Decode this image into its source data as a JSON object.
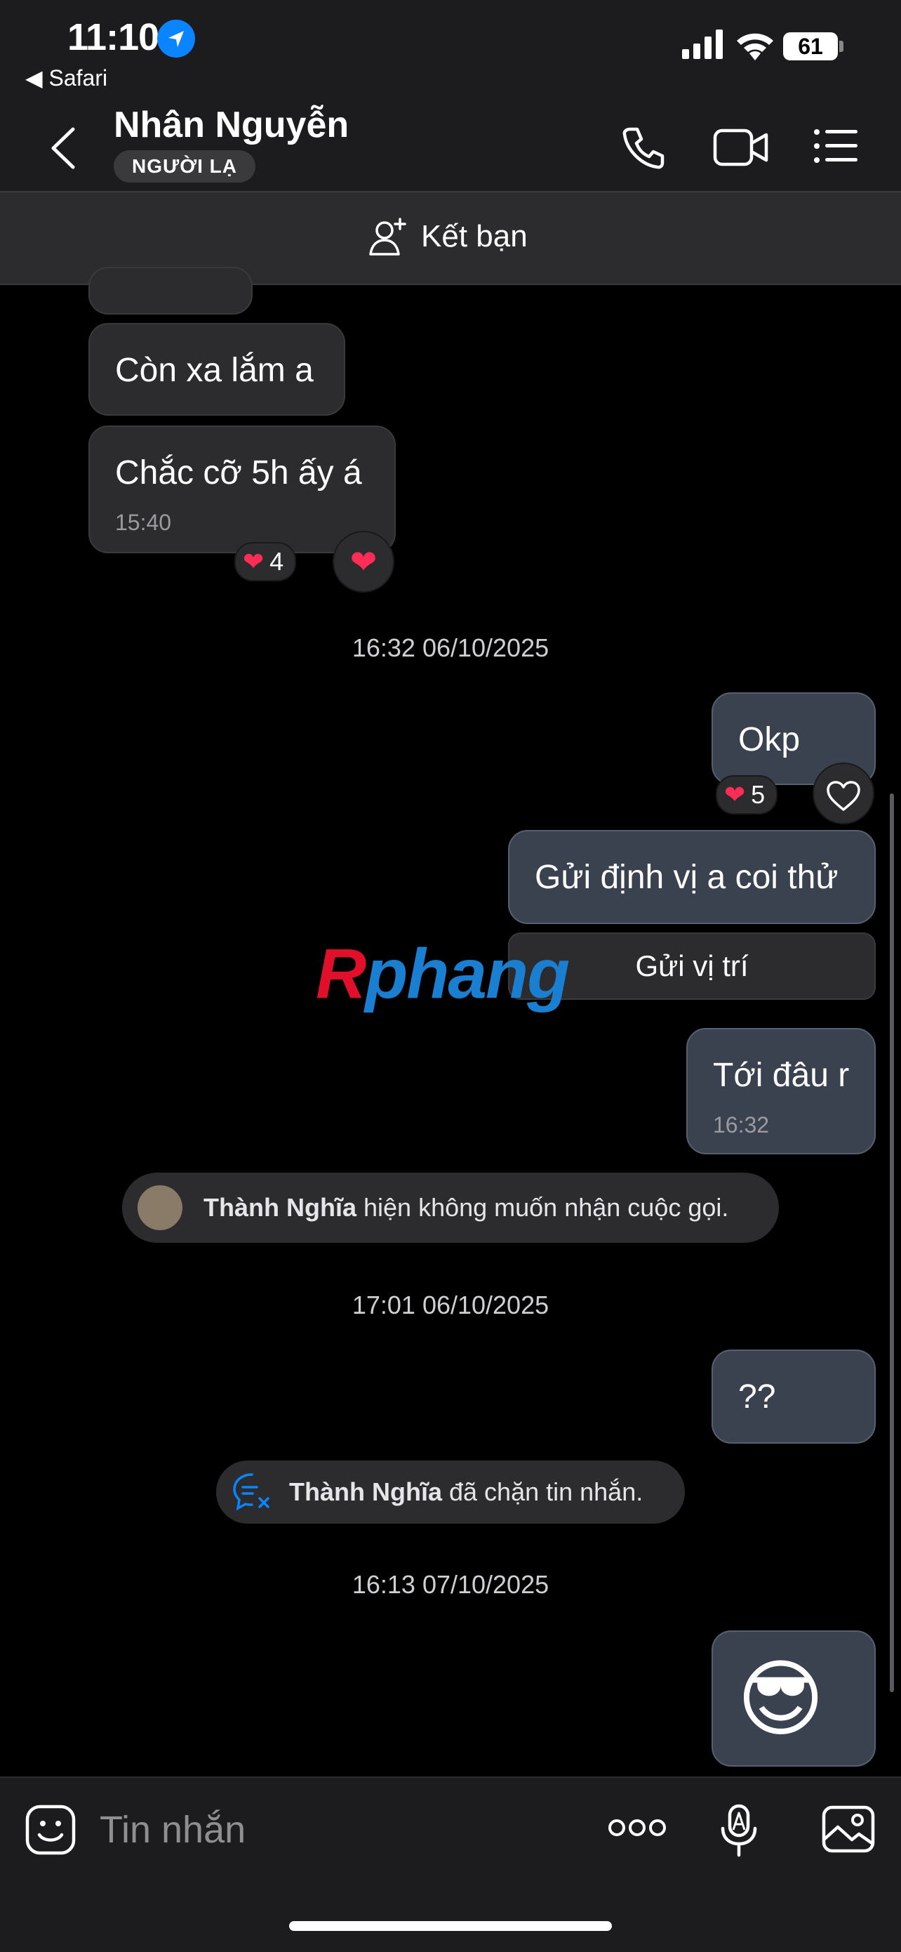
{
  "status_bar": {
    "time": "11:10",
    "back_app": "◀ Safari",
    "battery": "61"
  },
  "header": {
    "name": "Nhân Nguyễn",
    "badge": "NGƯỜI LẠ"
  },
  "friend_bar": {
    "label": "Kết bạn"
  },
  "messages": {
    "in_1": {
      "text": "Còn xa lắm a"
    },
    "in_2": {
      "text": "Chắc cỡ 5h ấy á",
      "time": "15:40",
      "reaction_count": "4"
    },
    "date_1": "16:32 06/10/2025",
    "out_1": {
      "text": "Okp",
      "reaction_count": "5"
    },
    "out_2": {
      "text": "Gửi định vị a coi thử",
      "button": "Gửi vị trí"
    },
    "out_3": {
      "text": "Tới đâu r",
      "time": "16:32"
    },
    "sys_1": {
      "name": "Thành Nghĩa",
      "text": " hiện không muốn nhận cuộc gọi."
    },
    "date_2": "17:01 06/10/2025",
    "out_4": {
      "text": "??"
    },
    "sys_2": {
      "name": "Thành Nghĩa",
      "text": " đã chặn tin nhắn."
    },
    "date_3": "16:13 07/10/2025",
    "out_5": {
      "emoji": "😎"
    }
  },
  "watermark": {
    "first": "R",
    "rest": "phang"
  },
  "input": {
    "placeholder": "Tin nhắn"
  },
  "colors": {
    "reaction_heart": "#ff2d55",
    "accent_blue": "#0a84ff"
  }
}
